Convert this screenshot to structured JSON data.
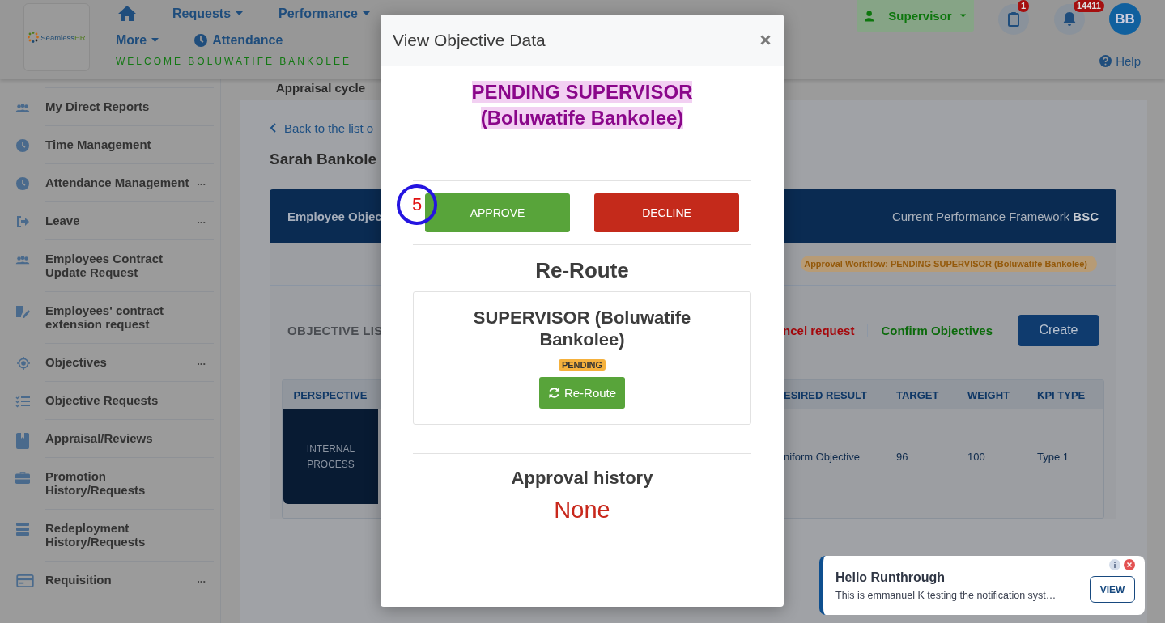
{
  "header": {
    "logo_text": "Seamless",
    "logo_accent": "HR",
    "nav": [
      {
        "kind": "home"
      },
      {
        "kind": "dropdown",
        "label": "Requests"
      },
      {
        "kind": "dropdown",
        "label": "Performance"
      },
      {
        "kind": "break"
      },
      {
        "kind": "dropdown",
        "label": "More"
      },
      {
        "kind": "clock",
        "label": "Attendance"
      }
    ],
    "welcome": "WELCOME BOLUWATIFE BANKOLEE",
    "role": "Supervisor",
    "tasks_badge": "1",
    "notifications_badge": "14411",
    "avatar_initials": "BB",
    "help": "Help"
  },
  "sidebar": {
    "items": [
      {
        "label": "My Direct Reports"
      },
      {
        "label": "Time Management"
      },
      {
        "label": "Attendance Management",
        "more": "..."
      },
      {
        "label": "Leave",
        "more": "..."
      },
      {
        "label": "Employees Contract Update Request"
      },
      {
        "label": "Employees' contract extension request"
      },
      {
        "label": "Objectives",
        "more": "..."
      },
      {
        "label": "Objective Requests"
      },
      {
        "label": "Appraisal/Reviews"
      },
      {
        "label": "Promotion History/Requests"
      },
      {
        "label": "Redeployment History/Requests"
      },
      {
        "label": "Requisition",
        "more": "..."
      }
    ]
  },
  "main": {
    "appraisal_label": "Appraisal cycle",
    "back_link": "Back to the list o",
    "employee_name": "Sarah Bankole",
    "card_title": "Employee Objec",
    "framework": "Current Performance Framework **BSC**",
    "workflow": "Approval Workflow: PENDING SUPERVISOR (Boluwatife Bankolee)",
    "list_title": "OBJECTIVE LIS",
    "actions": [
      {
        "kind": "danger",
        "label": "ncel request"
      },
      {
        "kind": "success",
        "label": "Confirm Objectives"
      },
      {
        "kind": "primary",
        "label": "Create"
      }
    ],
    "table": {
      "columns": [
        "PERSPECTIVE",
        "ESIRED RESULT",
        "TARGET",
        "WEIGHT",
        "KPI TYPE"
      ],
      "rows": [
        {
          "cells": [
            "INTERNAL PROCESS",
            "niform Objective",
            "96",
            "100",
            "Type 1"
          ]
        }
      ]
    }
  },
  "modal": {
    "title": "View Objective Data",
    "status": "PENDING SUPERVISOR (Boluwatife Bankolee)",
    "step_marker": "5",
    "approve": "APPROVE",
    "decline": "DECLINE",
    "reroute_heading": "Re-Route",
    "approver": {
      "name": "SUPERVISOR (Boluwatife Bankolee)",
      "status": "PENDING",
      "button": "Re-Route"
    },
    "history_heading": "Approval history",
    "history_value": "None"
  },
  "toast": {
    "title": "Hello Runthrough",
    "message": "This is emmanuel K testing the notification syst…",
    "button": "VIEW"
  }
}
